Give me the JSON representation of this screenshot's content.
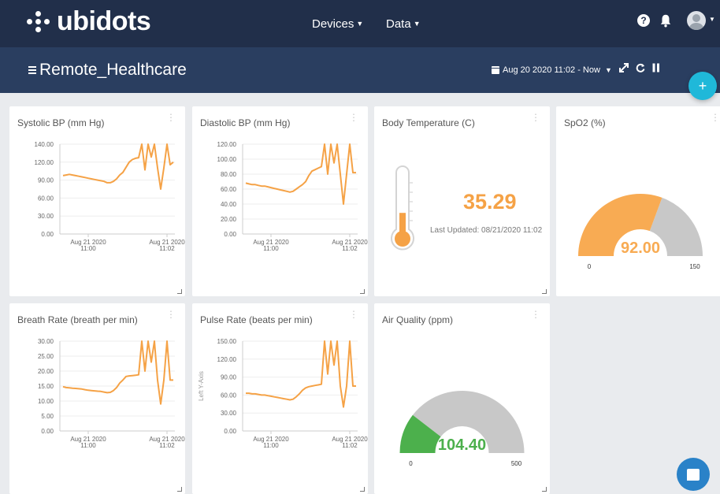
{
  "brand": {
    "name": "ubidots"
  },
  "nav": {
    "devices": "Devices",
    "data": "Data"
  },
  "header": {
    "help": "?"
  },
  "dashboard": {
    "title": "Remote_Healthcare",
    "date_range": "Aug 20 2020 11:02 - Now",
    "add_label": "+"
  },
  "colors": {
    "topbar": "#212f4a",
    "subbar": "#2a3e60",
    "series": "#f5a246",
    "gauge_fill": "#f8ab53",
    "gauge_green": "#4cb04c",
    "gauge_empty": "#c8c8c8",
    "fab": "#1fb8d9"
  },
  "widgets": {
    "systolic": {
      "title": "Systolic BP (mm Hg)",
      "chart_data": {
        "type": "line",
        "yticks": [
          "140.00",
          "120.00",
          "90.00",
          "60.00",
          "30.00",
          "0.00"
        ],
        "ylim": [
          0,
          140
        ],
        "xticks": [
          {
            "date": "Aug 21 2020",
            "time": "11:00"
          },
          {
            "date": "Aug 21 2020",
            "time": "11:02"
          }
        ],
        "values": [
          91,
          92,
          93,
          92,
          91,
          90,
          89,
          88,
          87,
          86,
          85,
          84,
          83,
          82,
          80,
          80,
          82,
          86,
          92,
          96,
          104,
          112,
          116,
          118,
          119,
          140,
          100,
          140,
          120,
          140,
          103,
          70,
          103,
          140,
          108,
          112
        ]
      }
    },
    "diastolic": {
      "title": "Diastolic BP (mm Hg)",
      "chart_data": {
        "type": "line",
        "yticks": [
          "120.00",
          "100.00",
          "80.00",
          "60.00",
          "40.00",
          "20.00",
          "0.00"
        ],
        "ylim": [
          0,
          120
        ],
        "xticks": [
          {
            "date": "Aug 21 2020",
            "time": "11:00"
          },
          {
            "date": "Aug 21 2020",
            "time": "11:02"
          }
        ],
        "values": [
          68,
          67,
          66,
          66,
          65,
          64,
          64,
          63,
          62,
          61,
          60,
          59,
          58,
          57,
          56,
          57,
          60,
          63,
          66,
          70,
          78,
          84,
          86,
          88,
          90,
          120,
          80,
          120,
          95,
          120,
          80,
          40,
          80,
          120,
          82,
          82
        ]
      }
    },
    "body_temp": {
      "title": "Body Temperature (C)",
      "value": "35.29",
      "updated": "Last Updated: 08/21/2020 11:02",
      "level": 0.4
    },
    "spo2": {
      "title": "SpO2 (%)",
      "value": "92.00",
      "min": "0",
      "max": "150",
      "fraction": 0.613
    },
    "breath": {
      "title": "Breath Rate (breath per min)",
      "chart_data": {
        "type": "line",
        "yticks": [
          "30.00",
          "25.00",
          "20.00",
          "15.00",
          "10.00",
          "5.00",
          "0.00"
        ],
        "ylim": [
          0,
          30
        ],
        "xticks": [
          {
            "date": "Aug 21 2020",
            "time": "11:00"
          },
          {
            "date": "Aug 21 2020",
            "time": "11:02"
          }
        ],
        "values": [
          14.8,
          14.5,
          14.4,
          14.3,
          14.2,
          14.1,
          14.0,
          13.8,
          13.6,
          13.5,
          13.4,
          13.3,
          13.2,
          13.0,
          12.8,
          12.9,
          13.5,
          14.5,
          16,
          17,
          18.2,
          18.4,
          18.5,
          18.6,
          18.8,
          30,
          20,
          30,
          23,
          30,
          17,
          9,
          17,
          30,
          17,
          17
        ]
      }
    },
    "pulse": {
      "title": "Pulse Rate (beats per min)",
      "chart_data": {
        "type": "line",
        "yticks": [
          "150.00",
          "120.00",
          "90.00",
          "60.00",
          "30.00",
          "0.00"
        ],
        "ylim": [
          0,
          150
        ],
        "ylabel": "Left Y-Axis",
        "xticks": [
          {
            "date": "Aug 21 2020",
            "time": "11:00"
          },
          {
            "date": "Aug 21 2020",
            "time": "11:02"
          }
        ],
        "values": [
          63,
          63,
          62,
          62,
          61,
          60,
          60,
          59,
          58,
          57,
          56,
          55,
          54,
          53,
          52,
          53,
          57,
          62,
          68,
          72,
          74,
          75,
          76,
          77,
          78,
          150,
          95,
          150,
          110,
          150,
          75,
          40,
          75,
          150,
          75,
          75
        ]
      }
    },
    "air": {
      "title": "Air Quality (ppm)",
      "value": "104.40",
      "min": "0",
      "max": "500",
      "fraction": 0.209
    }
  }
}
